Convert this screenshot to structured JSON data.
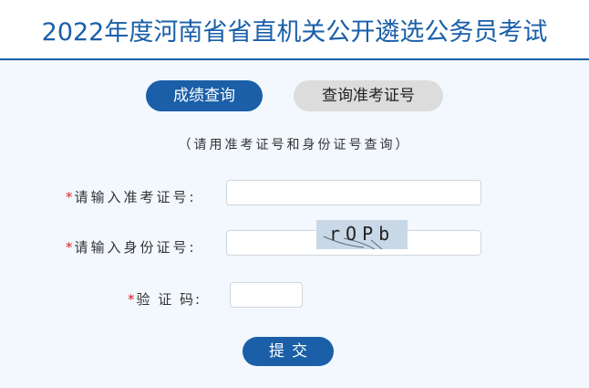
{
  "header": {
    "title": "2022年度河南省省直机关公开遴选公务员考试"
  },
  "tabs": [
    {
      "label": "成绩查询",
      "active": true
    },
    {
      "label": "查询准考证号",
      "active": false
    }
  ],
  "hint": "（请用准考证号和身份证号查询）",
  "form": {
    "required_mark": "*",
    "exam_id": {
      "label": "请输入准考证号:",
      "value": ""
    },
    "id_card": {
      "label": "请输入身份证号:",
      "value": ""
    },
    "captcha": {
      "label": "验 证 码:",
      "value": "",
      "image_text": "rOPb"
    }
  },
  "submit_label": "提交",
  "colors": {
    "brand": "#1a5fa8",
    "panel_bg": "#f2f8fd",
    "required": "#e02020"
  }
}
